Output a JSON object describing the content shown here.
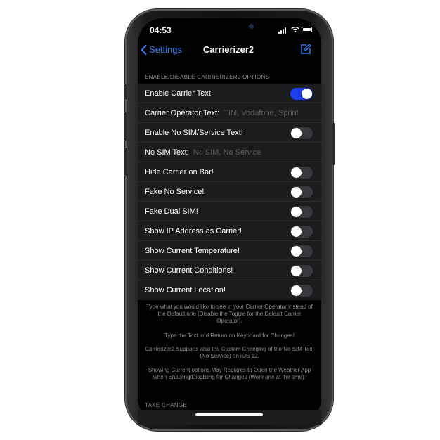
{
  "status_bar": {
    "time": "04:53"
  },
  "nav": {
    "back_label": "Settings",
    "title": "Carrierizer2"
  },
  "section1": {
    "header": "ENABLE/DISABLE CARRIERIZER2 OPTIONS"
  },
  "rows": [
    {
      "label": "Enable Carrier Text!",
      "type": "toggle",
      "on": true
    },
    {
      "label": "Carrier Operator Text:",
      "type": "text",
      "placeholder": "TIM, Vodafone, Sprint"
    },
    {
      "label": "Enable No SIM/Service Text!",
      "type": "toggle",
      "on": false
    },
    {
      "label": "No SIM Text:",
      "type": "text",
      "placeholder": "No SIM, No Service"
    },
    {
      "label": "Hide Carrier on Bar!",
      "type": "toggle",
      "on": false
    },
    {
      "label": "Fake No Service!",
      "type": "toggle",
      "on": false
    },
    {
      "label": "Fake Dual SIM!",
      "type": "toggle",
      "on": false
    },
    {
      "label": "Show IP Address as Carrier!",
      "type": "toggle",
      "on": false
    },
    {
      "label": "Show Current Temperature!",
      "type": "toggle",
      "on": false
    },
    {
      "label": "Show Current Conditions!",
      "type": "toggle",
      "on": false
    },
    {
      "label": "Show Current Location!",
      "type": "toggle",
      "on": false
    }
  ],
  "footer": {
    "p1": "Type what you would like to see in your Carrier Operator instead of the Default one (Disable the Toggle for the Default Carrier Operator).",
    "p2": "Type the Text and Return on Keyboard for Changes!",
    "p3": "Carrierizer2 Supports also the Custom Changing of the No SIM Text (No Service) on iOS 12.",
    "p4": "Showing Current options May Requires to Open the Weather App when Enabling/Disabling for Changes (Work one at the time)."
  },
  "section2": {
    "header": "TAKE CHANGE"
  },
  "colors": {
    "accent": "#2f7cf6",
    "toggle_on": "#1f3df0",
    "cell_bg": "#1c1c1e"
  },
  "icons": {
    "back": "chevron-left-icon",
    "compose": "compose-icon",
    "signal": "signal-icon",
    "wifi": "wifi-icon",
    "battery": "battery-icon"
  }
}
